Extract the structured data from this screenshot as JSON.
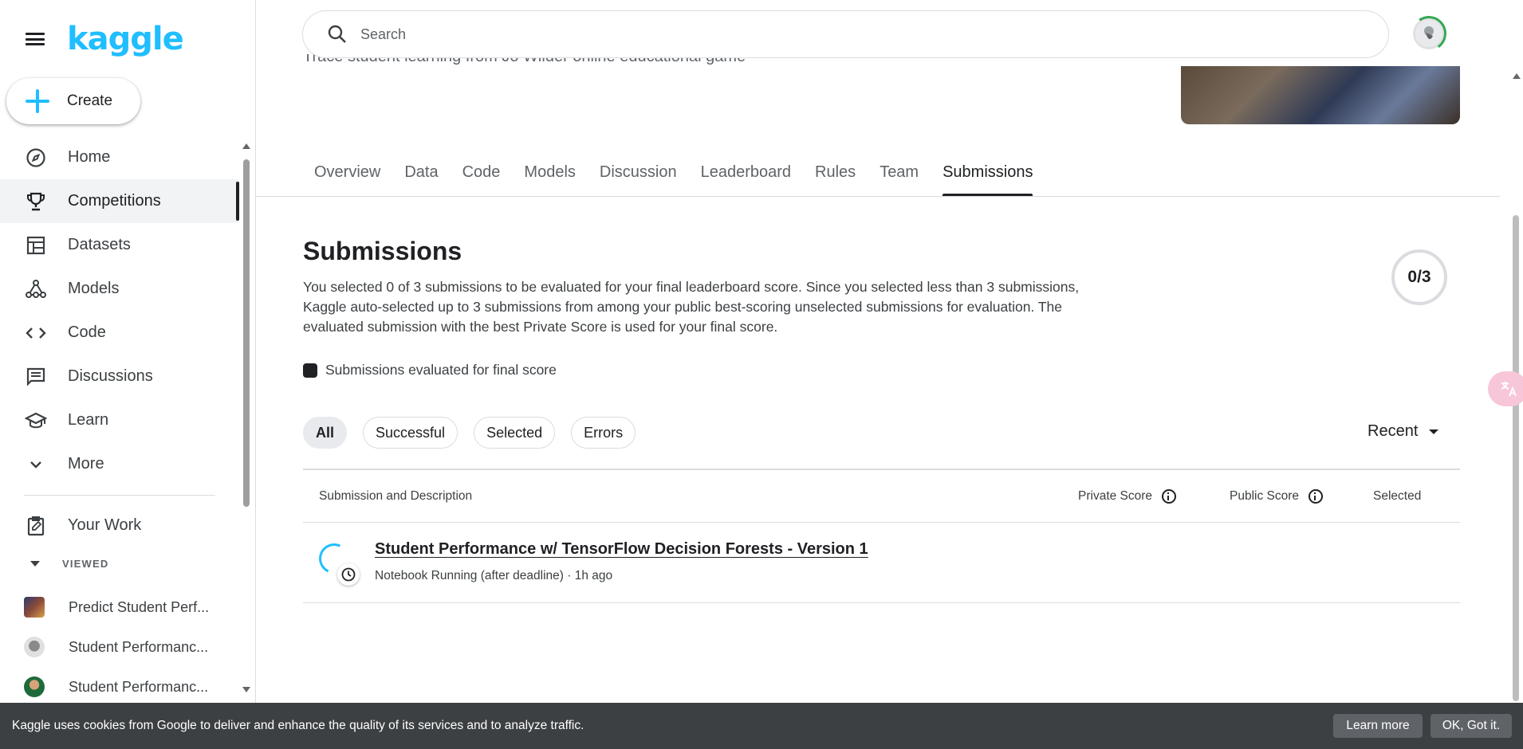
{
  "brand": {
    "logo_text": "kaggle",
    "accent": "#20beff"
  },
  "sidebar": {
    "create_label": "Create",
    "nav": [
      {
        "label": "Home",
        "icon": "compass-icon"
      },
      {
        "label": "Competitions",
        "icon": "trophy-icon",
        "active": true
      },
      {
        "label": "Datasets",
        "icon": "table-icon"
      },
      {
        "label": "Models",
        "icon": "models-icon"
      },
      {
        "label": "Code",
        "icon": "code-icon"
      },
      {
        "label": "Discussions",
        "icon": "comments-icon"
      },
      {
        "label": "Learn",
        "icon": "school-icon"
      },
      {
        "label": "More",
        "icon": "chevron-down-icon"
      }
    ],
    "your_work_label": "Your Work",
    "viewed_header": "VIEWED",
    "viewed": [
      {
        "label": "Predict Student Perf..."
      },
      {
        "label": "Student Performanc..."
      },
      {
        "label": "Student Performanc..."
      }
    ]
  },
  "search": {
    "placeholder": "Search"
  },
  "header": {
    "subtitle": "Trace student learning from Jo Wilder online educational game"
  },
  "tabs": [
    {
      "label": "Overview"
    },
    {
      "label": "Data"
    },
    {
      "label": "Code"
    },
    {
      "label": "Models"
    },
    {
      "label": "Discussion"
    },
    {
      "label": "Leaderboard"
    },
    {
      "label": "Rules"
    },
    {
      "label": "Team"
    },
    {
      "label": "Submissions",
      "active": true
    }
  ],
  "submissions": {
    "title": "Submissions",
    "description": "You selected 0 of 3 submissions to be evaluated for your final leaderboard score. Since you selected less than 3 submissions, Kaggle auto-selected up to 3 submissions from among your public best-scoring unselected submissions for evaluation. The evaluated submission with the best Private Score is used for your final score.",
    "counter": "0/3",
    "legend": "Submissions evaluated for final score",
    "filters": [
      "All",
      "Successful",
      "Selected",
      "Errors"
    ],
    "sort_label": "Recent",
    "columns": {
      "submission": "Submission and Description",
      "private_score": "Private Score",
      "public_score": "Public Score",
      "selected": "Selected"
    },
    "rows": [
      {
        "title": "Student Performance w/ TensorFlow Decision Forests - Version 1",
        "meta": "Notebook Running (after deadline) · 1h ago"
      }
    ]
  },
  "cookie": {
    "message": "Kaggle uses cookies from Google to deliver and enhance the quality of its services and to analyze traffic.",
    "learn_more": "Learn more",
    "ok": "OK, Got it."
  },
  "translate_icon": "translate-icon"
}
